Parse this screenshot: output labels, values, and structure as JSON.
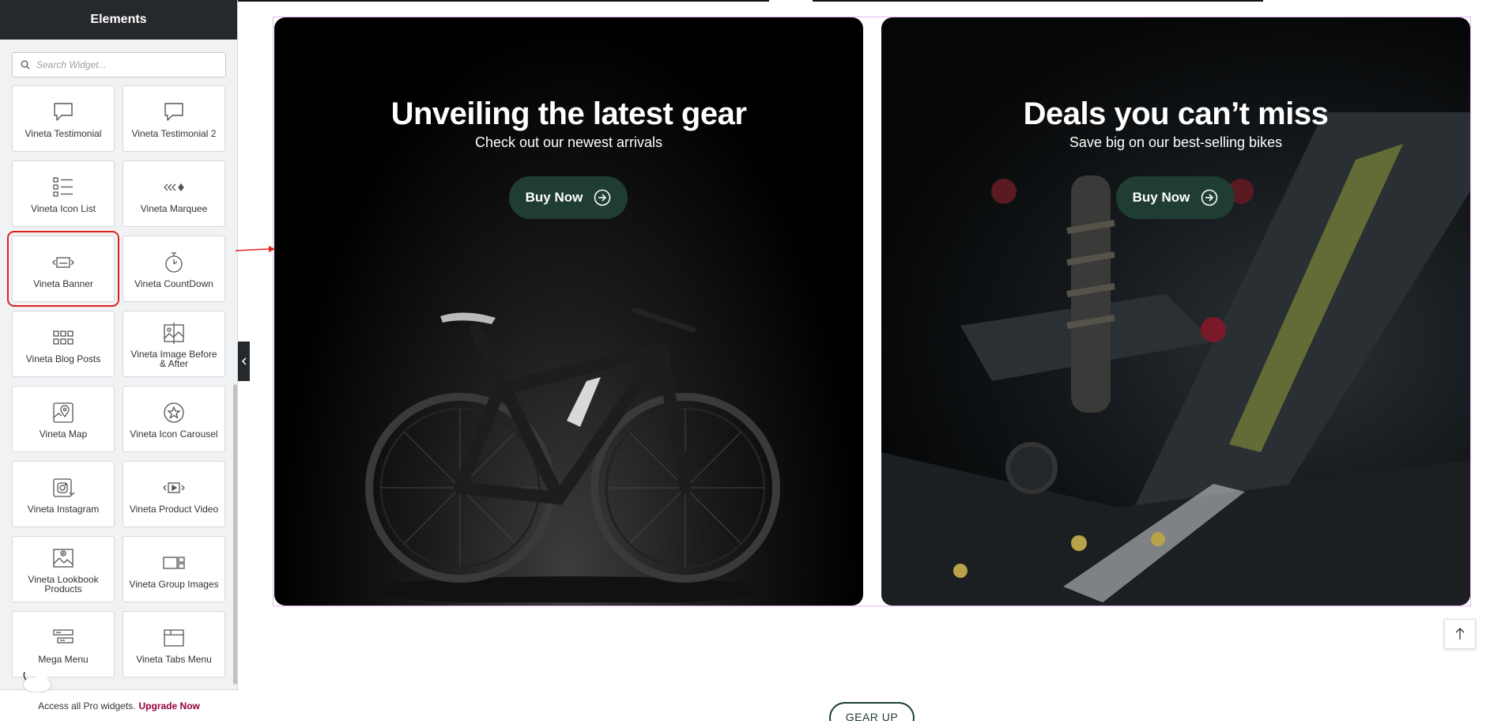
{
  "sidebar": {
    "title": "Elements",
    "search_placeholder": "Search Widget...",
    "widgets": [
      {
        "label": "Vineta Testimonial",
        "icon": "speech-bubble-icon"
      },
      {
        "label": "Vineta Testimonial 2",
        "icon": "speech-bubble-icon"
      },
      {
        "label": "Vineta Icon List",
        "icon": "icon-list-icon"
      },
      {
        "label": "Vineta Marquee",
        "icon": "marquee-icon"
      },
      {
        "label": "Vineta Banner",
        "icon": "banner-icon"
      },
      {
        "label": "Vineta CountDown",
        "icon": "stopwatch-icon"
      },
      {
        "label": "Vineta Blog Posts",
        "icon": "grid-posts-icon"
      },
      {
        "label": "Vineta Image Before & After",
        "icon": "image-compare-icon"
      },
      {
        "label": "Vineta Map",
        "icon": "map-icon"
      },
      {
        "label": "Vineta Icon Carousel",
        "icon": "star-circle-icon"
      },
      {
        "label": "Vineta Instagram",
        "icon": "instagram-icon"
      },
      {
        "label": "Vineta Product Video",
        "icon": "video-icon"
      },
      {
        "label": "Vineta Lookbook Products",
        "icon": "lookbook-icon"
      },
      {
        "label": "Vineta Group Images",
        "icon": "group-images-icon"
      },
      {
        "label": "Mega Menu",
        "icon": "mega-menu-icon"
      },
      {
        "label": "Vineta Tabs Menu",
        "icon": "tabs-icon"
      }
    ],
    "pro_text": "Access all Pro widgets.",
    "upgrade_label": "Upgrade Now"
  },
  "banners": [
    {
      "title": "Unveiling the latest gear",
      "subtitle": "Check out our newest arrivals",
      "button": "Buy Now"
    },
    {
      "title": "Deals you can’t miss",
      "subtitle": "Save big on our best-selling bikes",
      "button": "Buy Now"
    }
  ],
  "section_button": "GEAR UP",
  "colors": {
    "accent": "#1f3d33",
    "highlight": "#e02020",
    "upgrade": "#93003c"
  }
}
